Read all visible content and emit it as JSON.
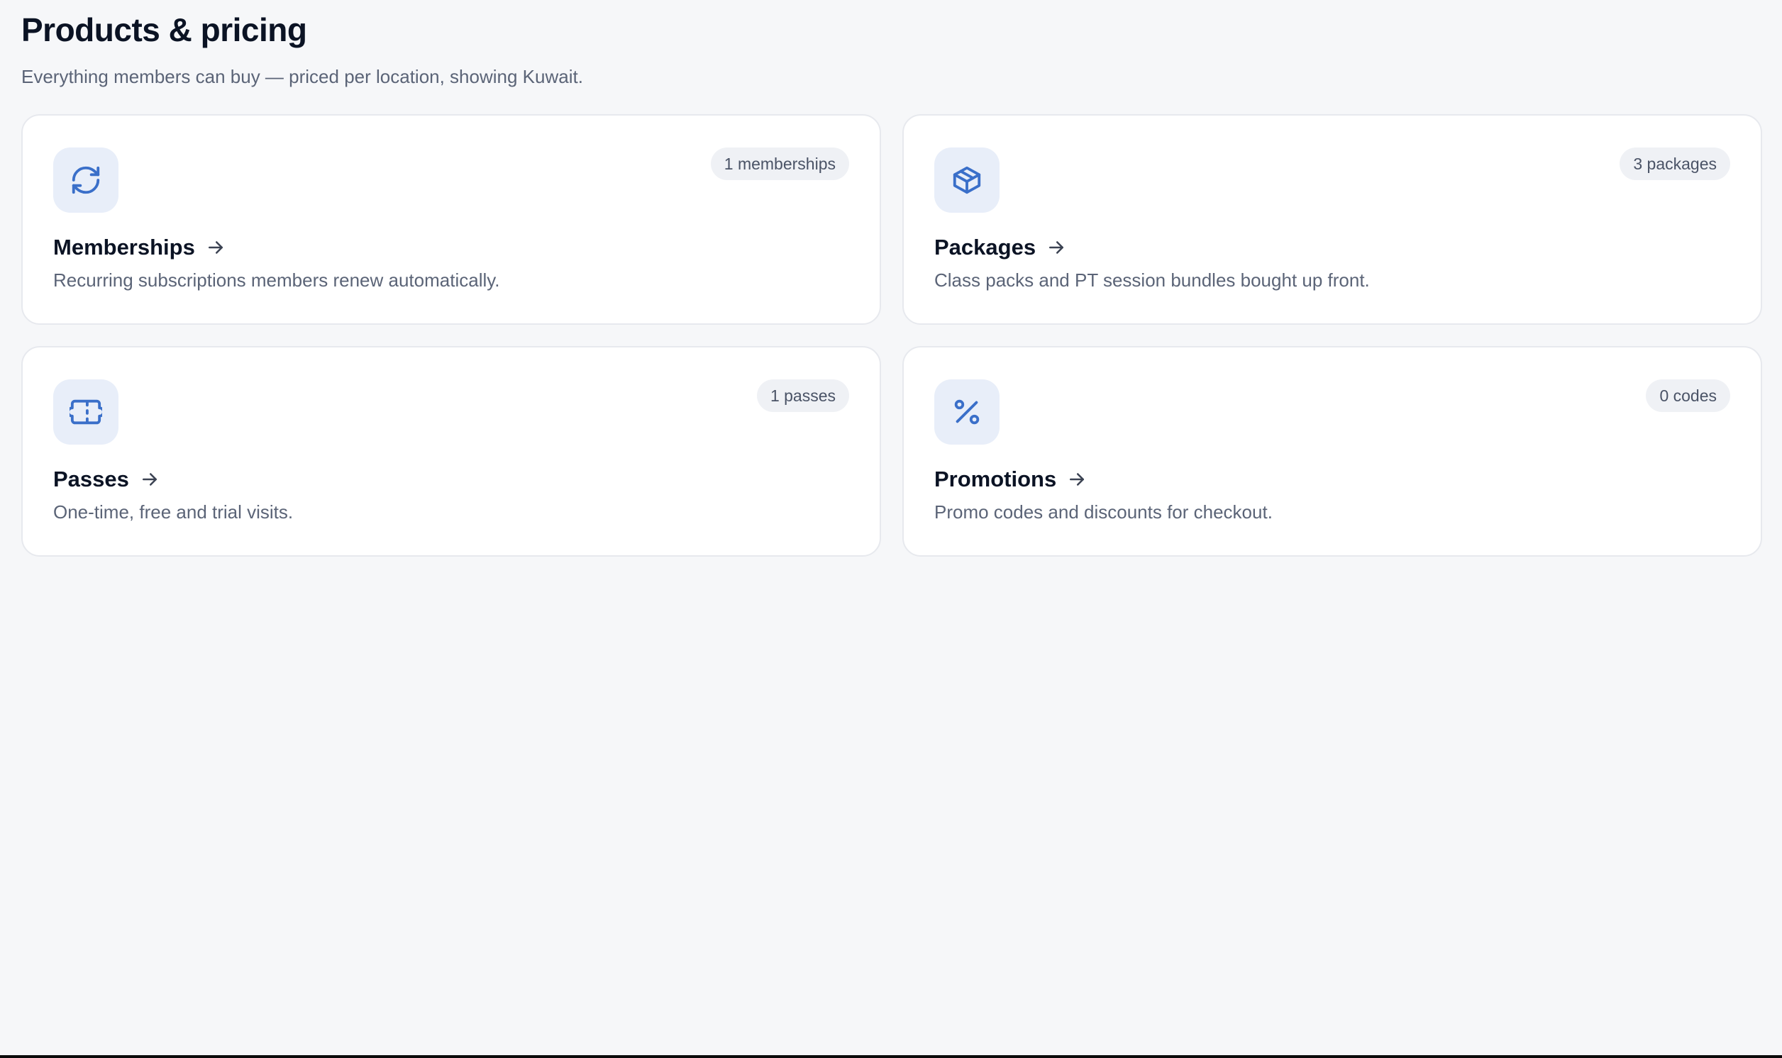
{
  "header": {
    "title": "Products & pricing",
    "subtitle": "Everything members can buy — priced per location, showing Kuwait."
  },
  "colors": {
    "accent": "#3a6fc9",
    "icon_bg": "#e8eef9",
    "badge_bg": "#eff1f5",
    "page_bg": "#f6f7f9"
  },
  "cards": [
    {
      "title": "Memberships",
      "description": "Recurring subscriptions members renew automatically.",
      "badge": "1 memberships",
      "icon": "refresh-icon"
    },
    {
      "title": "Packages",
      "description": "Class packs and PT session bundles bought up front.",
      "badge": "3 packages",
      "icon": "package-box-icon"
    },
    {
      "title": "Passes",
      "description": "One-time, free and trial visits.",
      "badge": "1 passes",
      "icon": "ticket-icon"
    },
    {
      "title": "Promotions",
      "description": "Promo codes and discounts for checkout.",
      "badge": "0 codes",
      "icon": "percent-icon"
    }
  ]
}
